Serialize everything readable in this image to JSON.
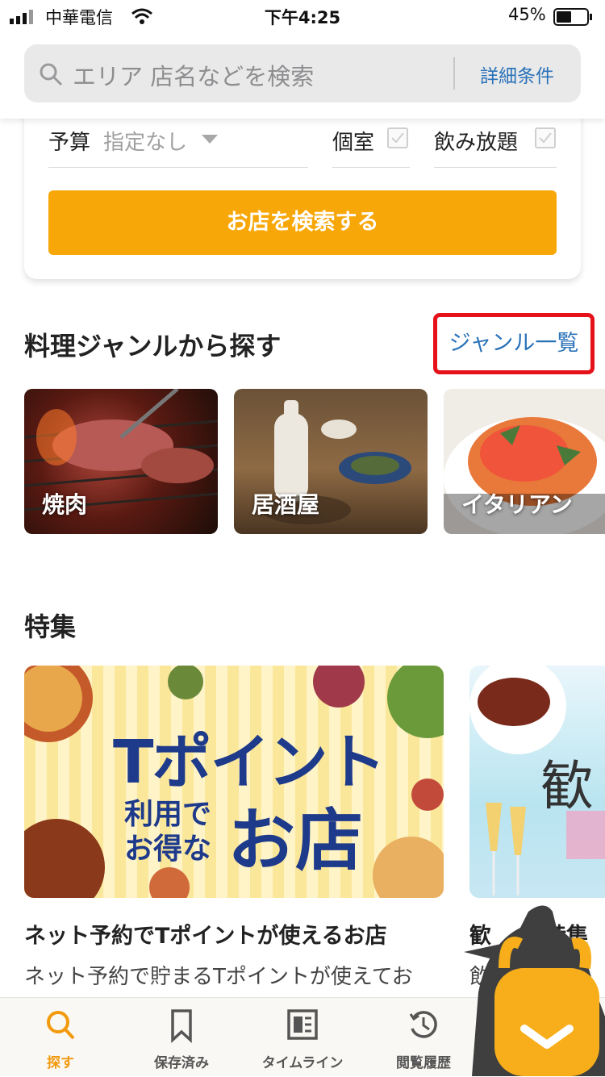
{
  "status_bar": {
    "carrier": "中華電信",
    "time": "下午4:25",
    "battery": "45%"
  },
  "search": {
    "placeholder": "エリア 店名などを検索",
    "detail_link": "詳細条件"
  },
  "filters": {
    "budget_label": "予算",
    "budget_value": "指定なし",
    "private_room_label": "個室",
    "all_you_can_drink_label": "飲み放題",
    "search_button": "お店を検索する"
  },
  "genre_section": {
    "title": "料理ジャンルから探す",
    "list_link": "ジャンル一覧",
    "genres": [
      {
        "label": "焼肉"
      },
      {
        "label": "居酒屋"
      },
      {
        "label": "イタリアン"
      }
    ]
  },
  "feature_section": {
    "title": "特集",
    "banner_text_1": "Tポイント",
    "banner_text_2": "利用で",
    "banner_text_3": "お得な",
    "banner_text_4": "お店",
    "banner2_text": "歓",
    "items": [
      {
        "title": "ネット予約でTポイントが使えるお店",
        "description": "ネット予約で貯まるTポイントが使えてお"
      },
      {
        "title": "歓",
        "title_suffix": "特集",
        "description": "飲"
      }
    ]
  },
  "tab_bar": {
    "tabs": [
      {
        "label": "探す",
        "icon": "search-icon",
        "active": true
      },
      {
        "label": "保存済み",
        "icon": "bookmark-icon",
        "active": false
      },
      {
        "label": "タイムライン",
        "icon": "timeline-icon",
        "active": false
      },
      {
        "label": "閲覧履歴",
        "icon": "history-icon",
        "active": false
      }
    ]
  },
  "colors": {
    "accent": "#f8a709",
    "link": "#2a72b8",
    "highlight_border": "#e5121b"
  }
}
